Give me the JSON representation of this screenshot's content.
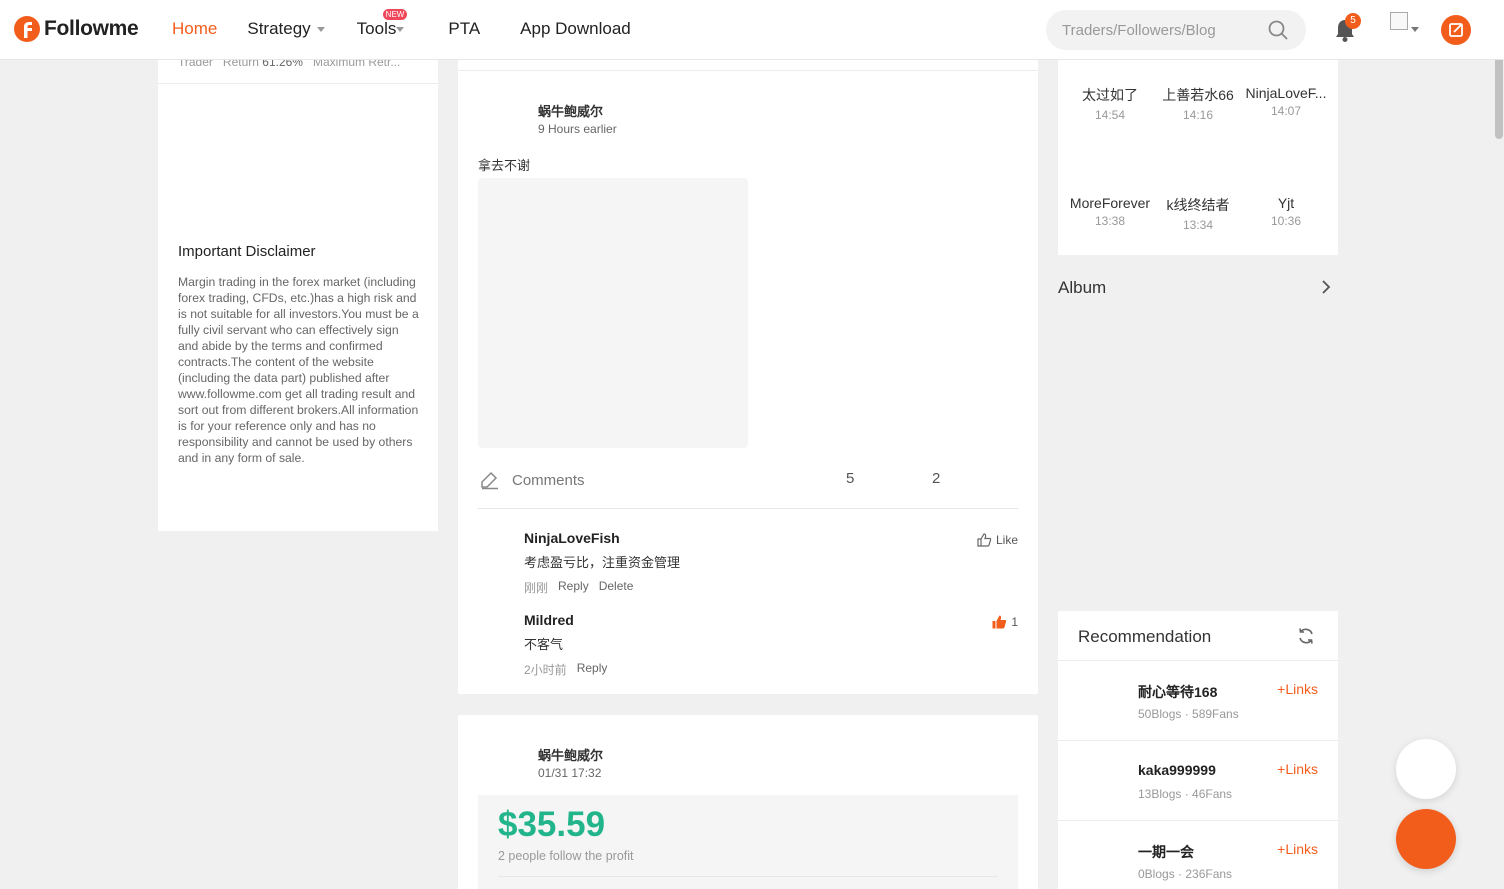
{
  "header": {
    "logo_text": "Followme",
    "nav": [
      {
        "label": "Home",
        "active": true
      },
      {
        "label": "Strategy",
        "dropdown": true
      },
      {
        "label": "Tools",
        "dropdown": true,
        "badge": "NEW"
      },
      {
        "label": "PTA"
      },
      {
        "label": "App Download"
      }
    ],
    "search_placeholder": "Traders/Followers/Blog",
    "notification_count": "5",
    "accent_color": "#f25d1c"
  },
  "left": {
    "stats_row": {
      "trader": "Trader",
      "return_label": "Return",
      "return_value": "61.26%",
      "max_label": "Maximum Retr..."
    },
    "disclaimer_title": "Important Disclaimer",
    "disclaimer_text": "Margin trading in the forex market (including forex trading, CFDs, etc.)has a high risk and is not suitable for all investors.You must be a fully civil servant who can effectively sign and abide by the terms and confirmed contracts.The content of the website (including the data part) published after www.followme.com get all trading result and sort out from different brokers.All information is for your reference only and has no responsibility and cannot be used by others and in any form of sale."
  },
  "posts": [
    {
      "author": "蜗牛鲍威尔",
      "time": "9 Hours earlier",
      "text": "拿去不谢",
      "comments_label": "Comments",
      "count_a": "5",
      "count_b": "2",
      "comments": [
        {
          "name": "NinjaLoveFish",
          "text": "考虑盈亏比，注重资金管理",
          "time": "刚刚",
          "reply": "Reply",
          "delete": "Delete",
          "like_label": "Like"
        },
        {
          "name": "Mildred",
          "text": "不客气",
          "time": "2小时前",
          "reply": "Reply",
          "like_count": "1"
        }
      ]
    },
    {
      "author": "蜗牛鲍威尔",
      "time": "01/31 17:32",
      "profit": "$35.59",
      "profit_sub": "2 people follow the profit"
    }
  ],
  "visitors": [
    {
      "name": "太过如了",
      "time": "14:54"
    },
    {
      "name": "上善若水66",
      "time": "14:16"
    },
    {
      "name": "NinjaLoveF...",
      "time": "14:07"
    },
    {
      "name": "MoreForever",
      "time": "13:38"
    },
    {
      "name": "k线终结者",
      "time": "13:34"
    },
    {
      "name": "Yjt",
      "time": "10:36"
    }
  ],
  "album_label": "Album",
  "recommendation": {
    "title": "Recommendation",
    "items": [
      {
        "name": "耐心等待168",
        "stats": "50Blogs · 589Fans",
        "link": "+Links"
      },
      {
        "name": "kaka999999",
        "stats": "13Blogs · 46Fans",
        "link": "+Links"
      },
      {
        "name": "一期一会",
        "stats": "0Blogs · 236Fans",
        "link": "+Links"
      }
    ]
  }
}
